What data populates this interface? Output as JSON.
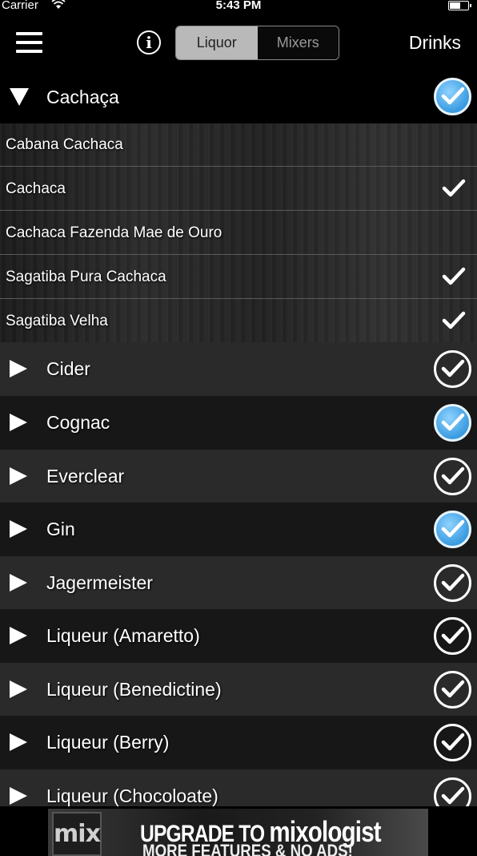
{
  "status_bar": {
    "carrier": "Carrier",
    "time": "5:43 PM"
  },
  "nav": {
    "info_label": "i",
    "segments": [
      "Liquor",
      "Mixers"
    ],
    "selected_segment": "Liquor",
    "right_button": "Drinks"
  },
  "expanded_category": {
    "name": "Cachaça",
    "checked": true,
    "items": [
      {
        "name": "Cabana Cachaca",
        "checked": false
      },
      {
        "name": "Cachaca",
        "checked": true
      },
      {
        "name": "Cachaca Fazenda Mae de Ouro",
        "checked": false
      },
      {
        "name": "Sagatiba Pura Cachaca",
        "checked": true
      },
      {
        "name": "Sagatiba Velha",
        "checked": true
      }
    ]
  },
  "categories": [
    {
      "name": "Cider",
      "selected": false
    },
    {
      "name": "Cognac",
      "selected": true
    },
    {
      "name": "Everclear",
      "selected": false
    },
    {
      "name": "Gin",
      "selected": true
    },
    {
      "name": "Jagermeister",
      "selected": false
    },
    {
      "name": "Liqueur (Amaretto)",
      "selected": false
    },
    {
      "name": "Liqueur (Benedictine)",
      "selected": false
    },
    {
      "name": "Liqueur (Berry)",
      "selected": false
    },
    {
      "name": "Liqueur (Chocoloate)",
      "selected": false
    }
  ],
  "banner": {
    "logo_text": "mix",
    "headline_prefix": "UPGRADE TO ",
    "headline_brand": "mixologist",
    "subline": "MORE FEATURES & NO ADS!"
  },
  "colors": {
    "selected_check": "#3a9be0",
    "row_light": "#2a2a2a",
    "row_dark": "#171717"
  }
}
